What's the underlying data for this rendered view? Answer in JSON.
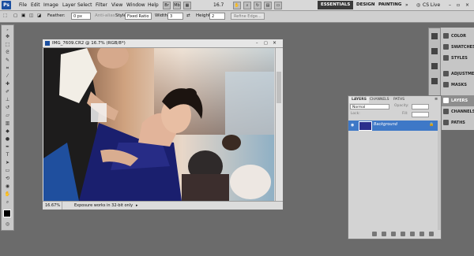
{
  "menubar": {
    "logo": "Ps",
    "items": [
      "File",
      "Edit",
      "Image",
      "Layer",
      "Select",
      "Filter",
      "View",
      "Window",
      "Help"
    ],
    "zoom": "16.7",
    "workspaces": [
      "ESSENTIALS",
      "DESIGN",
      "PAINTING"
    ],
    "cslive": "CS Live"
  },
  "options": {
    "feather_label": "Feather:",
    "feather_value": "0 px",
    "antialias": "Anti-alias",
    "style_label": "Style:",
    "style_value": "Fixed Ratio",
    "width_label": "Width:",
    "width_value": "3",
    "height_label": "Height:",
    "height_value": "2",
    "refine_edge": "Refine Edge..."
  },
  "document": {
    "title": "IMG_7609.CR2 @ 16.7% (RGB/8*)",
    "zoom": "16.67%",
    "status": "Exposure works in 32-bit only"
  },
  "dock": {
    "items": [
      "COLOR",
      "SWATCHES",
      "STYLES",
      "ADJUSTMENTS",
      "MASKS",
      "LAYERS",
      "CHANNELS",
      "PATHS"
    ],
    "selected": "LAYERS"
  },
  "layers_panel": {
    "tabs": [
      "LAYERS",
      "CHANNELS",
      "PATHS"
    ],
    "blend_mode": "Normal",
    "opacity_label": "Opacity:",
    "fill_label": "Fill:",
    "lock_label": "Lock:",
    "layer_name": "Background"
  },
  "colors": {
    "active_workspace": "#3a3a3a",
    "selected_layer": "#3e78c7",
    "ps_logo": "#1b4fa0"
  }
}
